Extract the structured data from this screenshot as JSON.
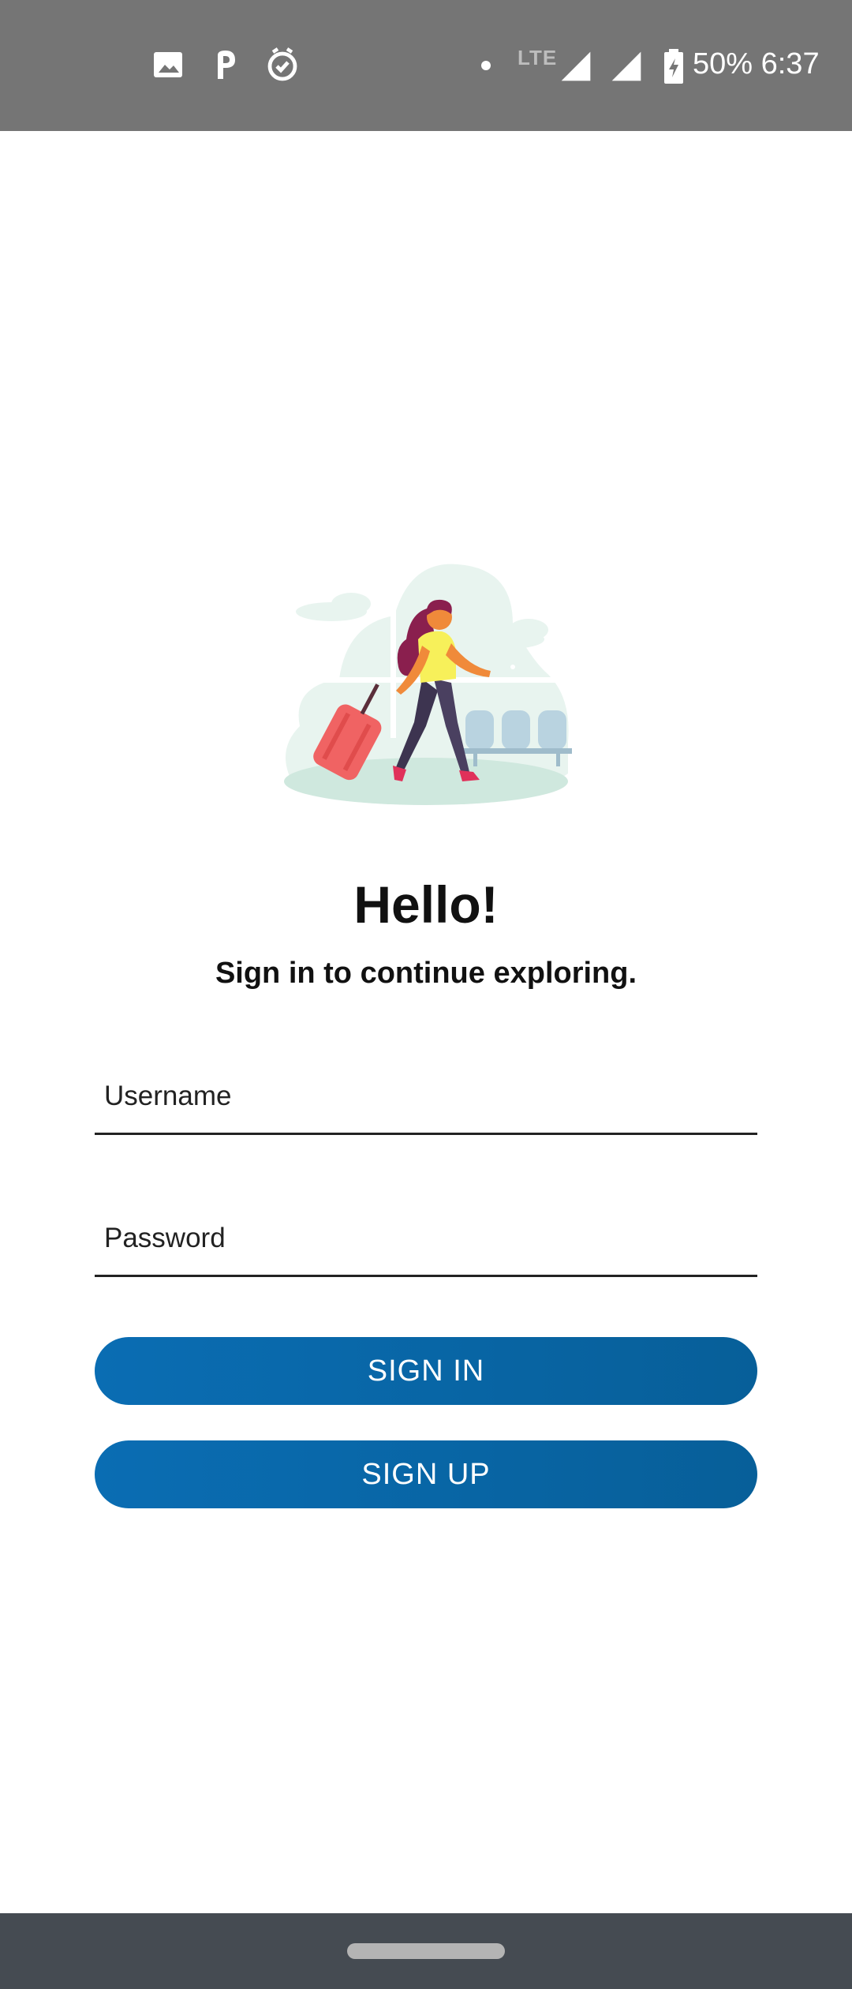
{
  "status_bar": {
    "icons": [
      "image-icon",
      "p-icon",
      "clock-check-icon"
    ],
    "network_label": "LTE",
    "status_text": "50% 6:37",
    "signal_icons": [
      "signal-icon",
      "signal-icon-2"
    ],
    "battery_icon": "battery-charging-icon"
  },
  "illustration": {
    "icon": "traveler-with-suitcase-illustration",
    "colors": {
      "background": "#e3f1ec",
      "shirt": "#f7f05a",
      "hair": "#8a1f4e",
      "suitcase": "#f06363",
      "pants": "#3d3450",
      "seats": "#b9d3e0"
    }
  },
  "header": {
    "title": "Hello!",
    "subtitle": "Sign in to continue exploring."
  },
  "form": {
    "username_placeholder": "Username",
    "password_placeholder": "Password",
    "signin_label": "SIGN IN",
    "signup_label": "SIGN UP"
  },
  "colors": {
    "status_bar": "#757575",
    "button": "#0a6db3",
    "nav_bar": "#454b52"
  }
}
